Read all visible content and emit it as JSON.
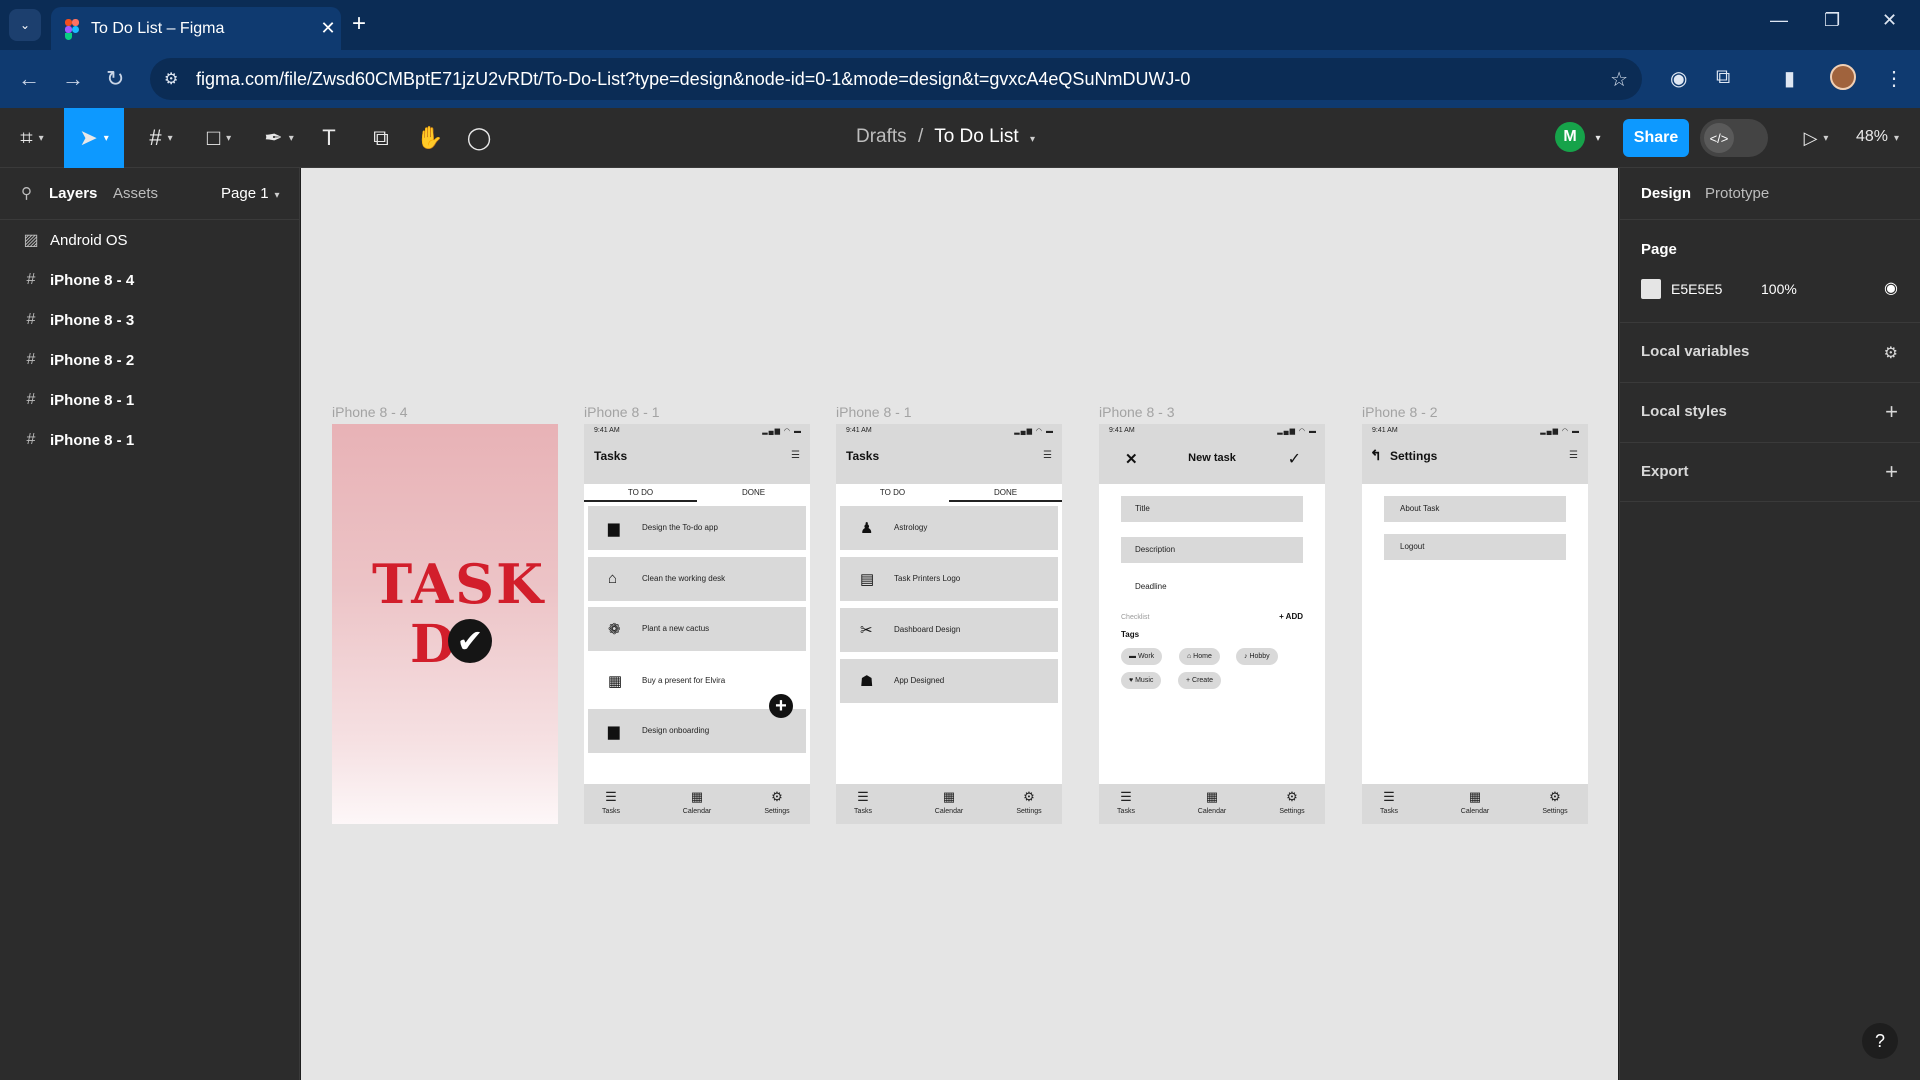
{
  "browser": {
    "tab_title": "To Do List – Figma",
    "tab_close": "✕",
    "new_tab": "+",
    "url": "figma.com/file/Zwsd60CMBptE71jzU2vRDt/To-Do-List?type=design&node-id=0-1&mode=design&t=gvxcA4eQSuNmDUWJ-0",
    "window_controls": [
      "—",
      "❐",
      "✕"
    ],
    "icons": [
      "back-icon",
      "forward-icon",
      "reload-icon",
      "site-info-icon",
      "bookmark-star-icon",
      "extension-icon",
      "sidebar-icon",
      "menu-icon"
    ]
  },
  "toolbar": {
    "breadcrumb_parent": "Drafts",
    "breadcrumb_sep": "/",
    "file_name": "To Do List",
    "user_initial": "M",
    "share_label": "Share",
    "zoom": "48%"
  },
  "left_panel": {
    "tab_layers": "Layers",
    "tab_assets": "Assets",
    "page_selector": "Page 1",
    "layers": [
      {
        "name": "Android OS",
        "icon": "image-icon"
      },
      {
        "name": "iPhone 8 - 4",
        "icon": "frame-icon"
      },
      {
        "name": "iPhone 8 - 3",
        "icon": "frame-icon"
      },
      {
        "name": "iPhone 8 - 2",
        "icon": "frame-icon"
      },
      {
        "name": "iPhone 8 - 1",
        "icon": "frame-icon"
      },
      {
        "name": "iPhone 8 - 1",
        "icon": "frame-icon"
      }
    ]
  },
  "canvas": {
    "background": "#E5E5E5",
    "frame_labels": [
      "iPhone 8 - 4",
      "iPhone 8 - 1",
      "iPhone 8 - 1",
      "iPhone 8 - 3",
      "iPhone 8 - 2"
    ],
    "splash": {
      "word1": "TASK",
      "word2": "D",
      "check": "✔"
    },
    "status_time": "9:41 AM",
    "status_icons": "▂▄▆ ◠ ▬",
    "tasks_title": "Tasks",
    "tab_todo": "TO DO",
    "tab_done": "DONE",
    "todo_items": [
      {
        "label": "Design the To-do app",
        "icon": "▆"
      },
      {
        "label": "Clean the working desk",
        "icon": "⌂"
      },
      {
        "label": "Plant a new cactus",
        "icon": "❁"
      },
      {
        "label": "Buy a present for Elvira",
        "icon": "▦"
      },
      {
        "label": "Design onboarding",
        "icon": "▆"
      }
    ],
    "done_items": [
      {
        "label": "Astrology",
        "icon": "♟"
      },
      {
        "label": "Task Printers Logo",
        "icon": "▤"
      },
      {
        "label": "Dashboard Design",
        "icon": "✂"
      },
      {
        "label": "App Designed",
        "icon": "☗"
      }
    ],
    "nav": [
      {
        "label": "Tasks",
        "icon": "☰"
      },
      {
        "label": "Calendar",
        "icon": "▦"
      },
      {
        "label": "Settings",
        "icon": "⚙"
      }
    ],
    "new_task": {
      "title": "New task",
      "close": "✕",
      "confirm": "✓",
      "field_title": "Title",
      "field_description": "Description",
      "deadline": "Deadline",
      "checklist": "Checklist",
      "add": "+ ADD",
      "tags_label": "Tags",
      "chips": [
        "▬ Work",
        "⌂ Home",
        "♪ Hobby",
        "♥ Music",
        "+ Create"
      ]
    },
    "settings": {
      "title": "Settings",
      "back": "↰",
      "about": "About Task",
      "logout": "Logout"
    }
  },
  "right_panel": {
    "tab_design": "Design",
    "tab_prototype": "Prototype",
    "page_heading": "Page",
    "page_color_hex": "E5E5E5",
    "page_opacity": "100%",
    "rows": [
      {
        "label": "Local variables",
        "action": "⚙"
      },
      {
        "label": "Local styles",
        "action": "+"
      },
      {
        "label": "Export",
        "action": "+"
      }
    ]
  },
  "help": "?"
}
